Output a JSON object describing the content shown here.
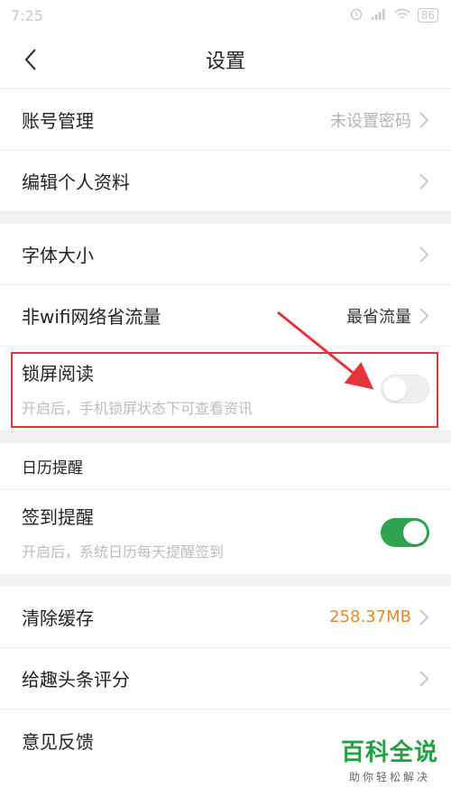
{
  "status_bar": {
    "time": "7:25",
    "battery": "86"
  },
  "header": {
    "title": "设置"
  },
  "group1": [
    {
      "label": "账号管理",
      "value": "未设置密码"
    },
    {
      "label": "编辑个人资料",
      "value": ""
    }
  ],
  "group2": {
    "font_size": {
      "label": "字体大小"
    },
    "data_saver": {
      "label": "非wifi网络省流量",
      "value": "最省流量"
    },
    "lock_read": {
      "label": "锁屏阅读",
      "subtitle": "开启后，手机锁屏状态下可查看资讯",
      "enabled": false
    }
  },
  "calendar": {
    "section_title": "日历提醒",
    "checkin": {
      "label": "签到提醒",
      "subtitle": "开启后，系统日历每天提醒签到",
      "enabled": true
    }
  },
  "group3": [
    {
      "label": "清除缓存",
      "value": "258.37MB"
    },
    {
      "label": "给趣头条评分",
      "value": ""
    },
    {
      "label": "意见反馈",
      "value": ""
    }
  ],
  "watermark": {
    "title": "百科全说",
    "subtitle": "助你轻松解决"
  },
  "colors": {
    "toggle_on": "#2ea44f",
    "cache_value": "#e08a2e",
    "highlight": "#e5343a",
    "watermark": "#23a041"
  }
}
